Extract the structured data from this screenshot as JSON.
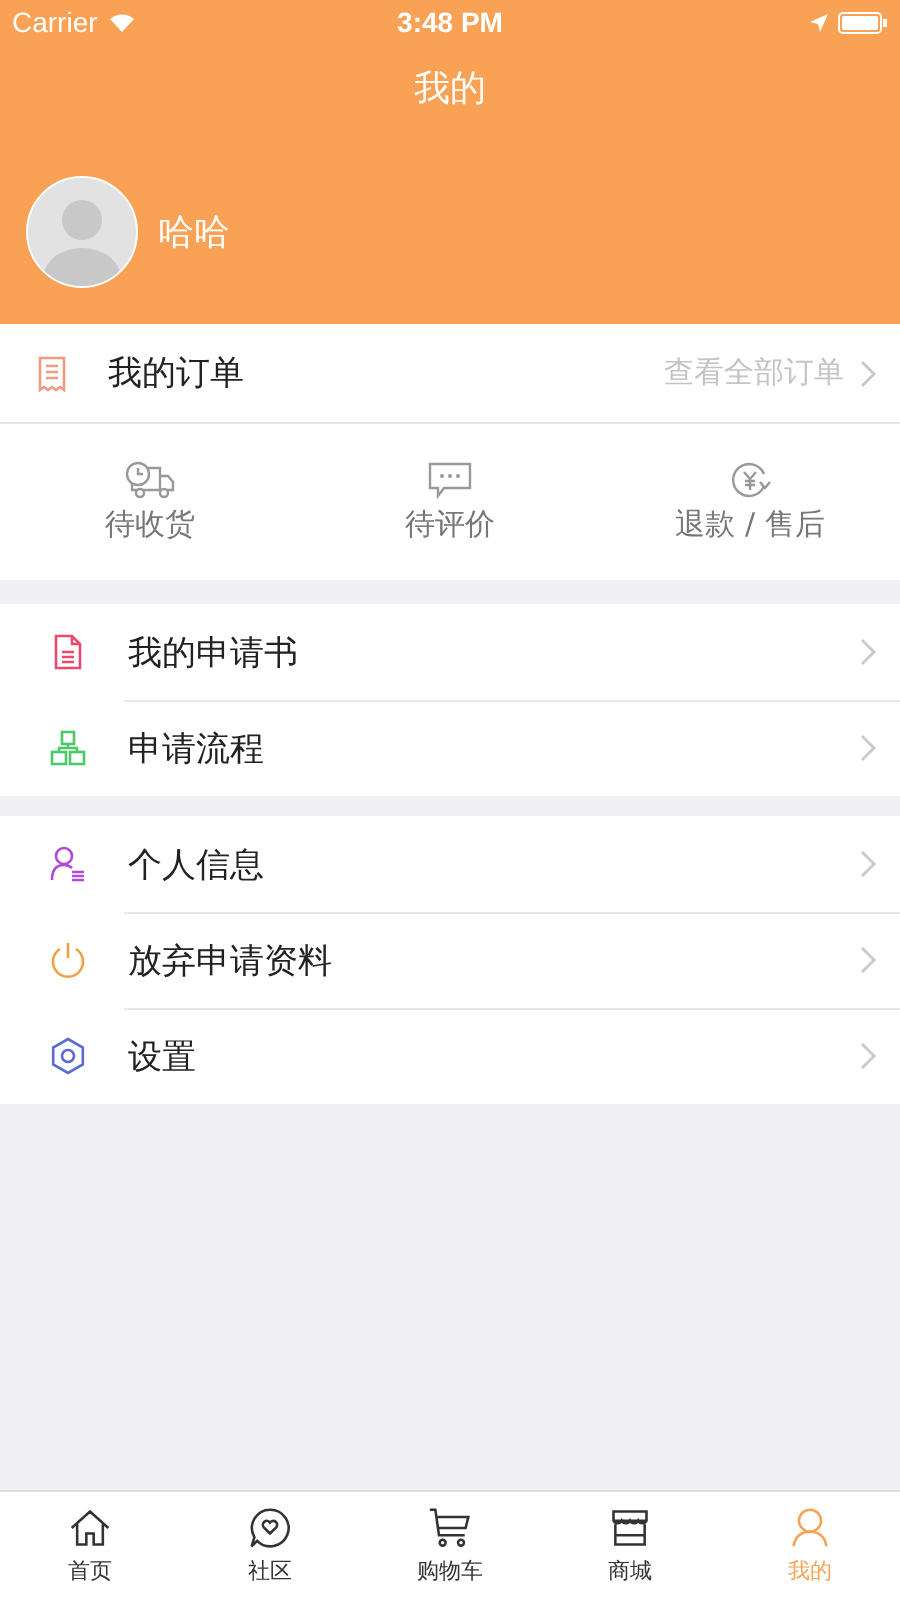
{
  "status_bar": {
    "carrier": "Carrier",
    "time": "3:48 PM"
  },
  "nav": {
    "title": "我的"
  },
  "profile": {
    "name": "哈哈"
  },
  "orders": {
    "title": "我的订单",
    "link": "查看全部订单",
    "statuses": [
      {
        "kind": "truck",
        "label": "待收货"
      },
      {
        "kind": "chat",
        "label": "待评价"
      },
      {
        "kind": "refund",
        "label": "退款 / 售后"
      }
    ]
  },
  "menu_groups": [
    [
      {
        "kind": "document",
        "label": "我的申请书"
      },
      {
        "kind": "flow",
        "label": "申请流程"
      }
    ],
    [
      {
        "kind": "person",
        "label": "个人信息"
      },
      {
        "kind": "power",
        "label": "放弃申请资料"
      },
      {
        "kind": "gear",
        "label": "设置"
      }
    ]
  ],
  "tab_bar": [
    {
      "kind": "home",
      "label": "首页",
      "selected": false
    },
    {
      "kind": "community",
      "label": "社区",
      "selected": false
    },
    {
      "kind": "cart",
      "label": "购物车",
      "selected": false
    },
    {
      "kind": "store",
      "label": "商城",
      "selected": false
    },
    {
      "kind": "person",
      "label": "我的",
      "selected": true
    }
  ]
}
